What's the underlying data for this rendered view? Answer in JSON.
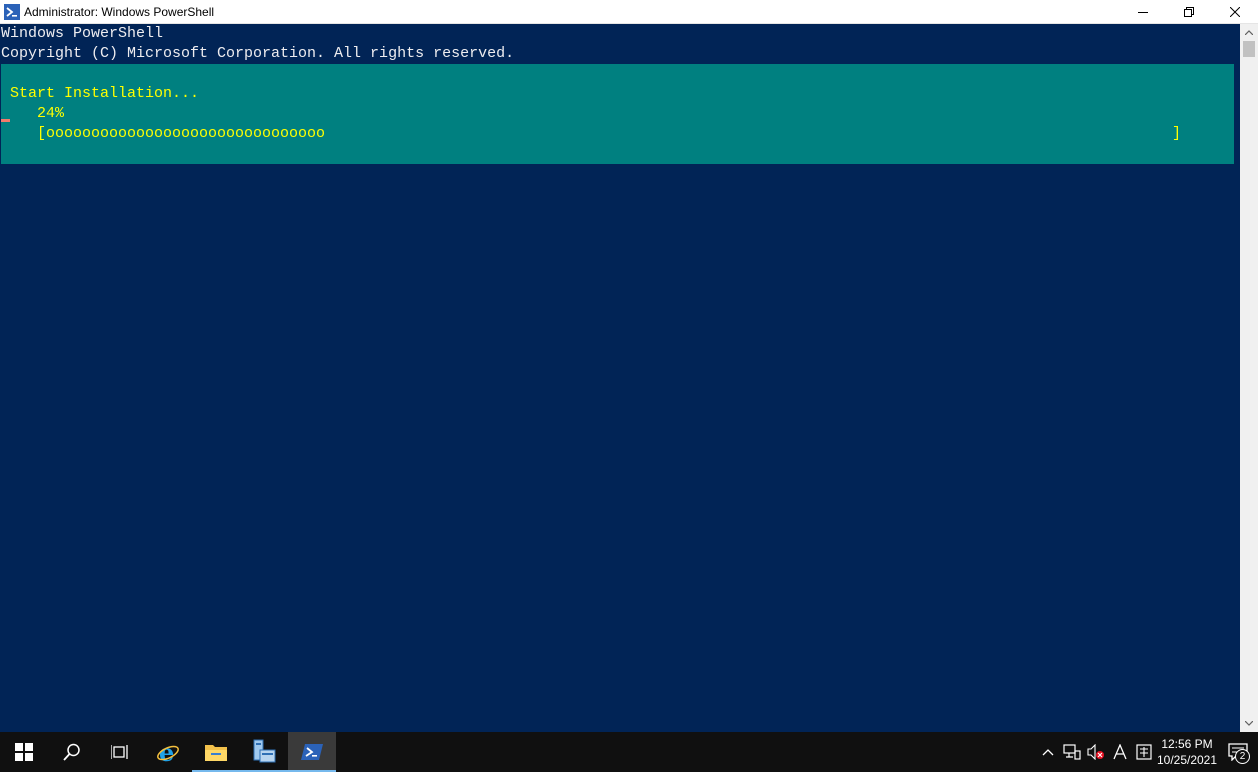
{
  "window": {
    "title": "Administrator: Windows PowerShell"
  },
  "console": {
    "lines": [
      "Windows PowerShell",
      "Copyright (C) Microsoft Corporation. All rights reserved."
    ],
    "progress": {
      "activity": "Start Installation...",
      "percent_label": "24%",
      "bar_text": "[ooooooooooooooooooooooooooooooo",
      "bar_end": "]",
      "percent": 24
    }
  },
  "colors": {
    "console_bg": "#012456",
    "progress_bg": "#008080",
    "progress_fg": "#ffff00"
  },
  "taskbar": {
    "items": [
      {
        "icon": "windows-start-icon"
      },
      {
        "icon": "search-icon"
      },
      {
        "icon": "task-view-icon"
      },
      {
        "icon": "internet-explorer-icon"
      },
      {
        "icon": "file-explorer-icon"
      },
      {
        "icon": "server-manager-icon"
      },
      {
        "icon": "powershell-icon",
        "active": true
      }
    ],
    "clock": {
      "time": "12:56 PM",
      "date": "10/25/2021"
    },
    "notification_count": "2"
  }
}
